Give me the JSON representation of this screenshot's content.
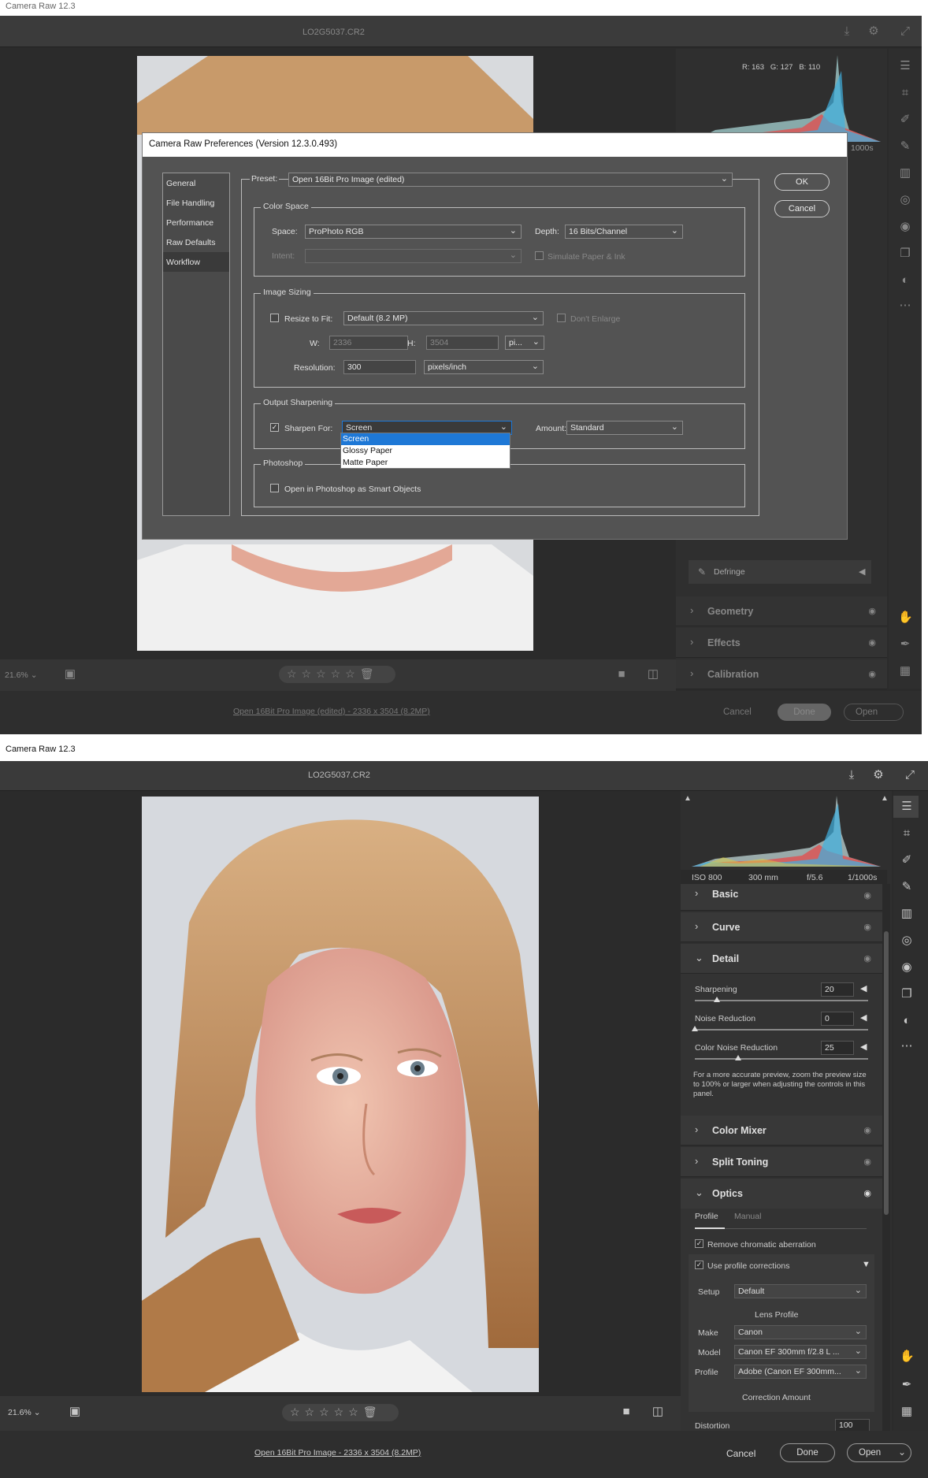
{
  "app": {
    "title": "Camera Raw 12.3",
    "filename": "LO2G5037.CR2"
  },
  "histogram": {
    "rgb": "R: 163   G: 127   B: 110"
  },
  "meta": {
    "iso": "ISO 800",
    "focal": "300 mm",
    "fstop": "f/5.6",
    "shutter": "1/1000s",
    "shutter_short": "1000s"
  },
  "sections": {
    "basic": "Basic",
    "curve": "Curve",
    "detail": "Detail",
    "color_mixer": "Color Mixer",
    "split_toning": "Split Toning",
    "optics": "Optics",
    "geometry": "Geometry",
    "effects": "Effects",
    "calibration": "Calibration",
    "defringe": "Defringe"
  },
  "detail": {
    "sharpening_label": "Sharpening",
    "sharpening": "20",
    "noise_label": "Noise Reduction",
    "noise": "0",
    "color_noise_label": "Color Noise Reduction",
    "color_noise": "25",
    "note": "For a more accurate preview, zoom the preview size to 100% or larger when adjusting the controls in this panel."
  },
  "optics": {
    "tab_profile": "Profile",
    "tab_manual": "Manual",
    "remove_ca": "Remove chromatic aberration",
    "use_profile": "Use profile corrections",
    "setup_label": "Setup",
    "setup": "Default",
    "lens_profile": "Lens Profile",
    "make_label": "Make",
    "make": "Canon",
    "model_label": "Model",
    "model": "Canon EF 300mm f/2.8 L ...",
    "profile_label": "Profile",
    "profile": "Adobe (Canon EF 300mm...",
    "correction_amount": "Correction Amount",
    "distortion_label": "Distortion",
    "distortion": "100"
  },
  "zoom": "21.6%",
  "footer": {
    "link_top": "Open 16Bit Pro Image (edited) - 2336 x 3504 (8.2MP)",
    "link_bottom": "Open 16Bit Pro Image - 2336 x 3504 (8.2MP)",
    "cancel": "Cancel",
    "done": "Done",
    "open": "Open"
  },
  "dialog": {
    "title": "Camera Raw Preferences  (Version 12.3.0.493)",
    "nav": [
      "General",
      "File Handling",
      "Performance",
      "Raw Defaults",
      "Workflow"
    ],
    "preset_label": "Preset:",
    "preset": "Open 16Bit Pro Image (edited)",
    "ok": "OK",
    "cancel": "Cancel",
    "color_space": "Color Space",
    "space_label": "Space:",
    "space": "ProPhoto RGB",
    "depth_label": "Depth:",
    "depth": "16 Bits/Channel",
    "intent_label": "Intent:",
    "simulate": "Simulate Paper & Ink",
    "image_sizing": "Image Sizing",
    "resize_label": "Resize to Fit:",
    "resize": "Default  (8.2 MP)",
    "dont_enlarge": "Don't Enlarge",
    "w_label": "W:",
    "w": "2336",
    "h_label": "H:",
    "h": "3504",
    "unit": "pi...",
    "resolution_label": "Resolution:",
    "resolution": "300",
    "res_unit": "pixels/inch",
    "output_sharpening": "Output Sharpening",
    "sharpen_label": "Sharpen For:",
    "sharpen": "Screen",
    "amount_label": "Amount:",
    "amount": "Standard",
    "options": [
      "Screen",
      "Glossy Paper",
      "Matte Paper"
    ],
    "photoshop": "Photoshop",
    "smart_objects": "Open in Photoshop as Smart Objects"
  }
}
